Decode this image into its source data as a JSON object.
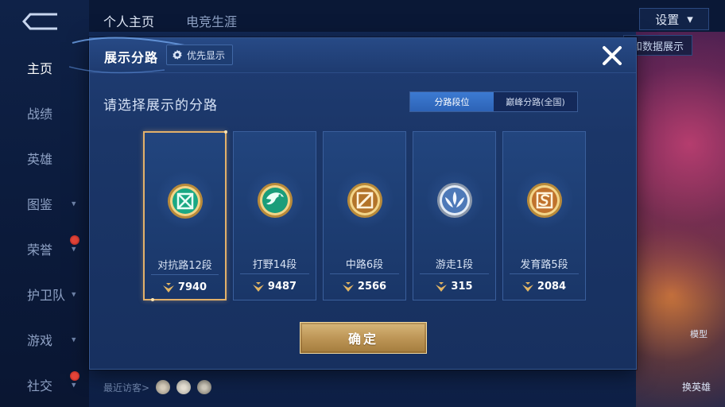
{
  "background": {
    "top_tabs": [
      "个人主页",
      "电竞生涯"
    ],
    "settings_label": "设置",
    "side_nav": [
      {
        "label": "主页",
        "active": true,
        "has_chevron": false,
        "badge": false
      },
      {
        "label": "战绩",
        "active": false,
        "has_chevron": false,
        "badge": false
      },
      {
        "label": "英雄",
        "active": false,
        "has_chevron": false,
        "badge": false
      },
      {
        "label": "图鉴",
        "active": false,
        "has_chevron": true,
        "badge": false
      },
      {
        "label": "荣誉",
        "active": false,
        "has_chevron": true,
        "badge": true
      },
      {
        "label": "护卫队",
        "active": false,
        "has_chevron": true,
        "badge": false
      },
      {
        "label": "游戏",
        "active": false,
        "has_chevron": true,
        "badge": false
      },
      {
        "label": "社交",
        "active": false,
        "has_chevron": true,
        "badge": true
      }
    ],
    "right_tag": "和数据展示",
    "right_label_1": "模型",
    "right_label_2": "换英雄",
    "recent_visitors_label": "最近访客>"
  },
  "modal": {
    "title": "展示分路",
    "priority_button": "优先显示",
    "section_title": "请选择展示的分路",
    "toggle": {
      "options": [
        "分路段位",
        "巅峰分路(全国)"
      ],
      "active_index": 0
    },
    "lanes": [
      {
        "rank": "对抗路12段",
        "score": "7940",
        "icon": "clash-lane-icon",
        "selected": true
      },
      {
        "rank": "打野14段",
        "score": "9487",
        "icon": "jungle-icon",
        "selected": false
      },
      {
        "rank": "中路6段",
        "score": "2566",
        "icon": "mid-lane-icon",
        "selected": false
      },
      {
        "rank": "游走1段",
        "score": "315",
        "icon": "roam-icon",
        "selected": false
      },
      {
        "rank": "发育路5段",
        "score": "2084",
        "icon": "farm-lane-icon",
        "selected": false
      }
    ],
    "confirm_label": "确定"
  },
  "colors": {
    "accent_gold": "#e2b06a",
    "toggle_active": "#3c7ad2",
    "modal_bg": "#1b3668"
  }
}
